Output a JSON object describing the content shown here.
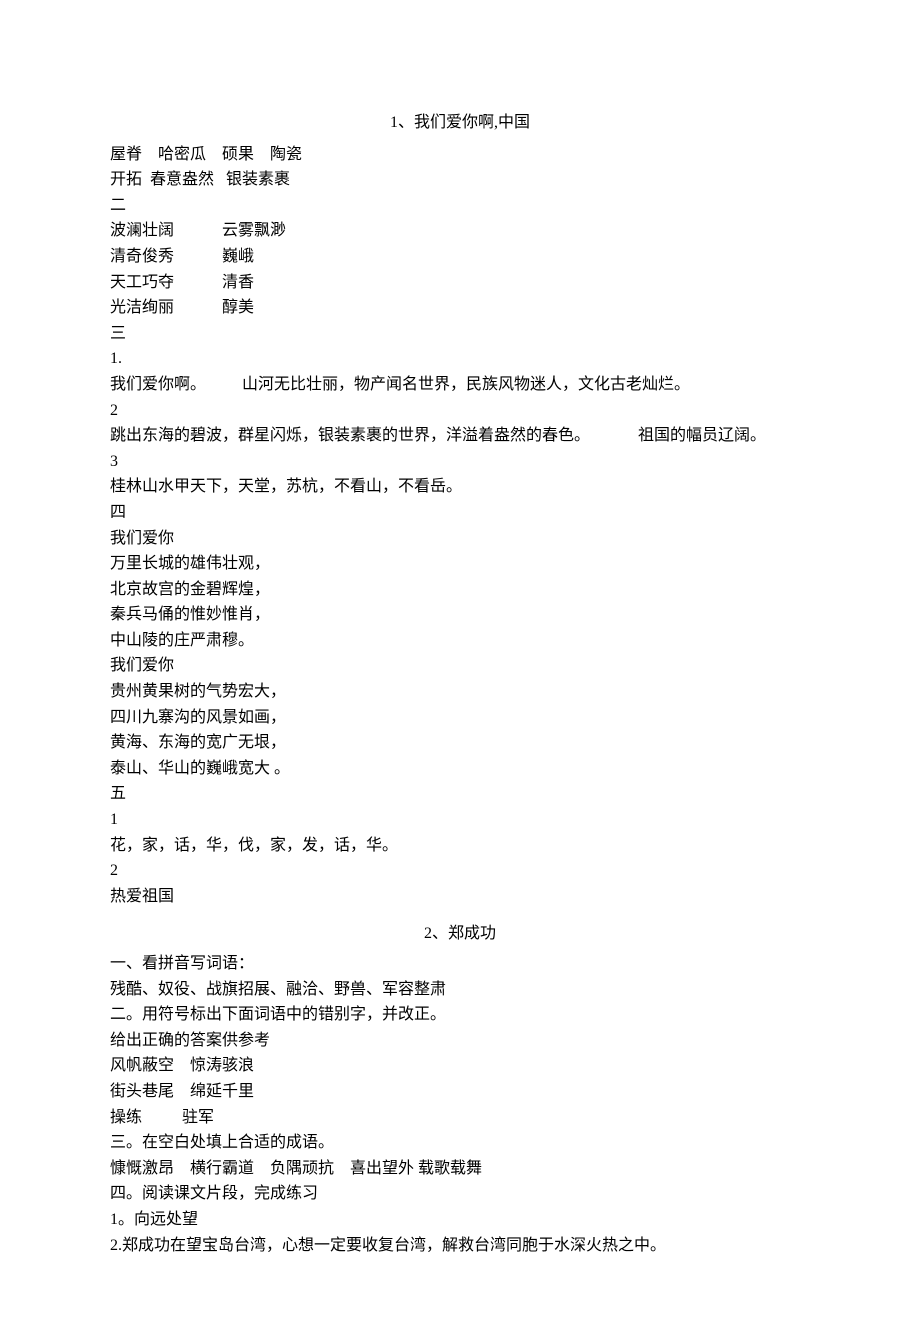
{
  "section1": {
    "title": "1、我们爱你啊,中国",
    "lines": [
      "屋脊    哈密瓜    硕果    陶瓷",
      "开拓  春意盎然   银装素裹",
      "二",
      "波澜壮阔            云雾飘渺",
      "清奇俊秀            巍峨",
      "天工巧夺            清香",
      "光洁绚丽            醇美",
      "三",
      "1.",
      "我们爱你啊。         山河无比壮丽，物产闻名世界，民族风物迷人，文化古老灿烂。",
      "2",
      "跳出东海的碧波，群星闪烁，银装素裹的世界，洋溢着盎然的春色。            祖国的幅员辽阔。",
      "3",
      "桂林山水甲天下，天堂，苏杭，不看山，不看岳。",
      "四",
      "我们爱你",
      "万里长城的雄伟壮观，",
      "北京故宫的金碧辉煌，",
      "秦兵马俑的惟妙惟肖，",
      "中山陵的庄严肃穆。",
      "我们爱你",
      "贵州黄果树的气势宏大，",
      "四川九寨沟的风景如画，",
      "黄海、东海的宽广无垠，",
      "泰山、华山的巍峨宽大 。",
      "五",
      "1",
      "花，家，话，华，伐，家，发，话，华。",
      "2",
      "热爱祖国"
    ]
  },
  "section2": {
    "title": "2、郑成功",
    "lines": [
      "一、看拼音写词语：",
      "残酷、奴役、战旗招展、融洽、野兽、军容整肃",
      "二。用符号标出下面词语中的错别字，并改正。",
      "给出正确的答案供参考",
      "风帆蔽空    惊涛骇浪",
      "街头巷尾    绵延千里",
      "操练          驻军",
      "三。在空白处填上合适的成语。",
      "慷慨激昂    横行霸道    负隅顽抗    喜出望外 载歌载舞",
      "四。阅读课文片段，完成练习",
      "1。向远处望",
      "2.郑成功在望宝岛台湾，心想一定要收复台湾，解救台湾同胞于水深火热之中。"
    ]
  }
}
